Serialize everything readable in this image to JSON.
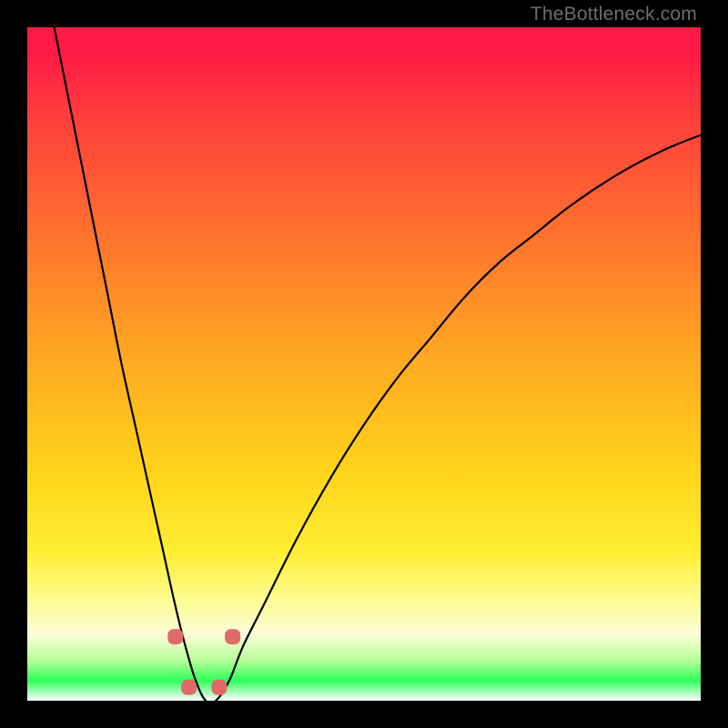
{
  "watermark": "TheBottleneck.com",
  "chart_data": {
    "type": "line",
    "title": "",
    "xlabel": "",
    "ylabel": "",
    "xlim": [
      0,
      100
    ],
    "ylim": [
      0,
      100
    ],
    "grid": false,
    "series": [
      {
        "name": "curve",
        "x": [
          4,
          6,
          8,
          10,
          12,
          14,
          16,
          18,
          20,
          22,
          23.5,
          25,
          26.5,
          28,
          30,
          32,
          35,
          40,
          45,
          50,
          55,
          60,
          65,
          70,
          75,
          80,
          85,
          90,
          95,
          100
        ],
        "y": [
          100,
          90,
          80,
          70,
          60,
          50,
          41,
          32,
          23,
          14,
          8,
          3,
          0,
          0,
          3,
          8,
          14,
          24,
          33,
          41,
          48,
          54,
          60,
          65,
          69,
          73,
          76.5,
          79.5,
          82,
          84
        ]
      }
    ],
    "markers": [
      {
        "x": 22.0,
        "y": 9.5
      },
      {
        "x": 30.5,
        "y": 9.5
      },
      {
        "x": 24.0,
        "y": 2.0
      },
      {
        "x": 28.5,
        "y": 2.0
      }
    ],
    "gradient_stops": [
      {
        "pos": 0.0,
        "color": "#ff1a44"
      },
      {
        "pos": 0.5,
        "color": "#ffa522"
      },
      {
        "pos": 0.8,
        "color": "#ffee33"
      },
      {
        "pos": 0.92,
        "color": "#fdfdd8"
      },
      {
        "pos": 0.97,
        "color": "#2eff5a"
      },
      {
        "pos": 1.0,
        "color": "#ffffff"
      }
    ]
  }
}
